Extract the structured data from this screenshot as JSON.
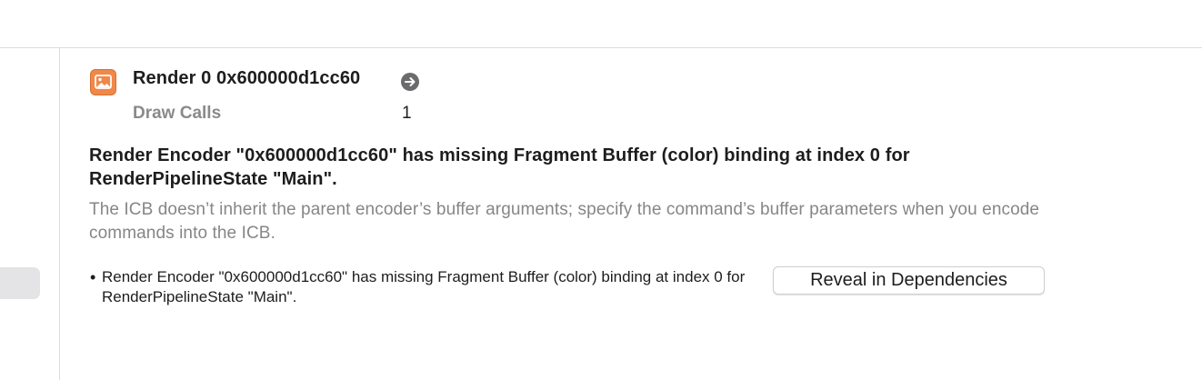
{
  "header": {
    "title": "Render 0 0x600000d1cc60",
    "encoder_icon": "image-icon",
    "go_icon": "arrow-right-circle-icon"
  },
  "stats": [
    {
      "label": "Draw Calls",
      "value": "1"
    }
  ],
  "issue": {
    "title": "Render Encoder \"0x600000d1cc60\" has missing Fragment Buffer (color) binding at index 0 for RenderPipelineState \"Main\".",
    "description": "The ICB doesn’t inherit the parent encoder’s buffer arguments; specify the command’s buffer parameters when you encode commands into the ICB.",
    "bullet_marker": "•",
    "bullet": "Render Encoder \"0x600000d1cc60\" has missing Fragment Buffer (color) binding at index 0 for RenderPipelineState \"Main\".",
    "action_label": "Reveal in Dependencies"
  },
  "colors": {
    "accent_icon": "#f0884a",
    "secondary_text": "#86868a",
    "divider": "#dcdcdc"
  }
}
